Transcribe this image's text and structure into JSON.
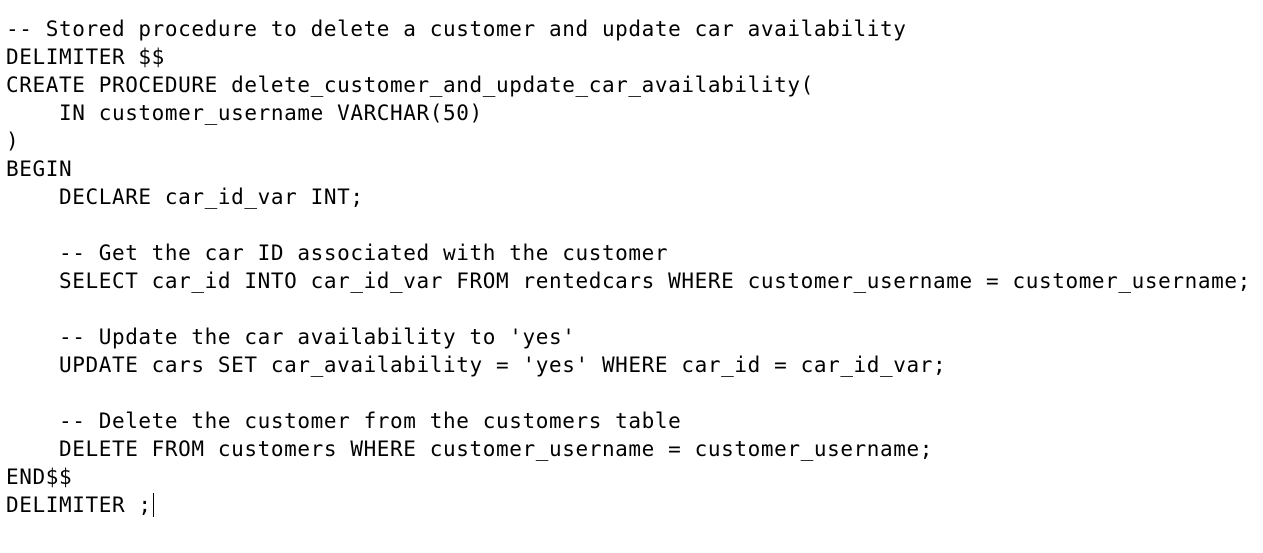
{
  "editor": {
    "lines": [
      "-- Stored procedure to delete a customer and update car availability",
      "DELIMITER $$",
      "CREATE PROCEDURE delete_customer_and_update_car_availability(",
      "    IN customer_username VARCHAR(50)",
      ")",
      "BEGIN",
      "    DECLARE car_id_var INT;",
      "",
      "    -- Get the car ID associated with the customer",
      "    SELECT car_id INTO car_id_var FROM rentedcars WHERE customer_username = customer_username;",
      "",
      "    -- Update the car availability to 'yes'",
      "    UPDATE cars SET car_availability = 'yes' WHERE car_id = car_id_var;",
      "",
      "    -- Delete the customer from the customers table",
      "    DELETE FROM customers WHERE customer_username = customer_username;",
      "END$$",
      "DELIMITER ;"
    ]
  }
}
